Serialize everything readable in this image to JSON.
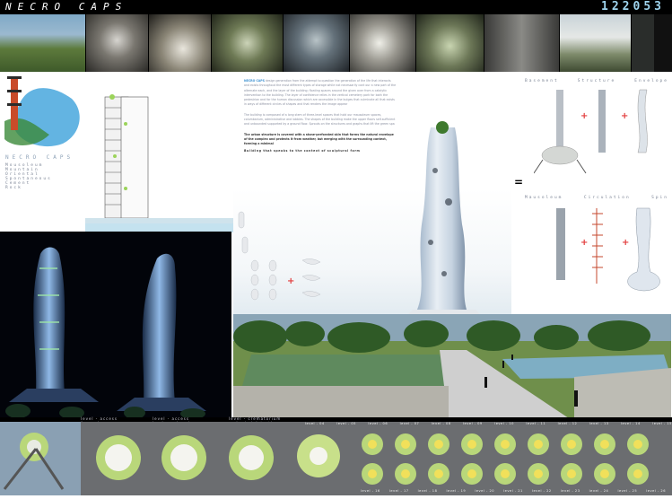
{
  "header": {
    "title": "NECRO CAPS",
    "code": "122053"
  },
  "left_panel": {
    "heading": "NECRO CAPS",
    "items": [
      "Mousoleum",
      "Mountain",
      "Oriental",
      "Spontaneous",
      "Cement",
      "Rock"
    ]
  },
  "text_block": {
    "lead": "NECRO CAPS",
    "paragraph_1": "design generation from the attempt to question the generation of the life that interacts and exists throughout the most different types of storage while not necessarily cont our a new part of the alternate each, and the layer of the building; floating spaces around the given over from a catalytic intervention to the building. The layer of confidence relies in the vertical cemetery park for both the pedestrian and for the human discussion which are accessible in the bulges that culminate all that exists in ways of different circles of shapes and that renders the image appear",
    "paragraph_2": "The building is composed of a long stem of three-level spaces that hold our mausoleum spaces, columbarium, administrative and lobbies. The shapes of the building make the upper floors self-sufficient and unbounded supported by a ground floor. Sprouts on the structures and graphs that lift the green spa",
    "paragraph_3": "The urban structure is covered with a stone-perforated skin that forms the natural envelope of the complex and protects it from weather, but merging with the surrounding context, forming a minimal",
    "tagline": "Building that speaks to the context of sculptural form"
  },
  "right_diagram": {
    "top_labels": [
      "Basement",
      "Structure",
      "Envelope"
    ],
    "bottom_labels": [
      "Mausoleum",
      "Circulation",
      "Spin"
    ],
    "plus": "+",
    "equals": "="
  },
  "render_captions": [
    "level - access funeral procession and sanatorium rooms",
    "level - access boulevard and sanatorium rooms",
    "level - crematorium and administrative area"
  ],
  "levels_top": [
    "level - 04",
    "level - 05",
    "level - 06",
    "level - 07",
    "level - 08",
    "level - 09",
    "level - 10",
    "level - 11",
    "level - 12",
    "level - 13",
    "level - 14",
    "level - 15"
  ],
  "levels_bottom": [
    "level - 16",
    "level - 17",
    "level - 18",
    "level - 19",
    "level - 20",
    "level - 21",
    "level - 22",
    "level - 23",
    "level - 24",
    "level - 25",
    "level - 26"
  ],
  "colors": {
    "accent_blue": "#9fd4ee",
    "plus_red": "#e23c3c",
    "plan_green": "#b9d77a",
    "plan_yellow": "#f1e05a"
  }
}
